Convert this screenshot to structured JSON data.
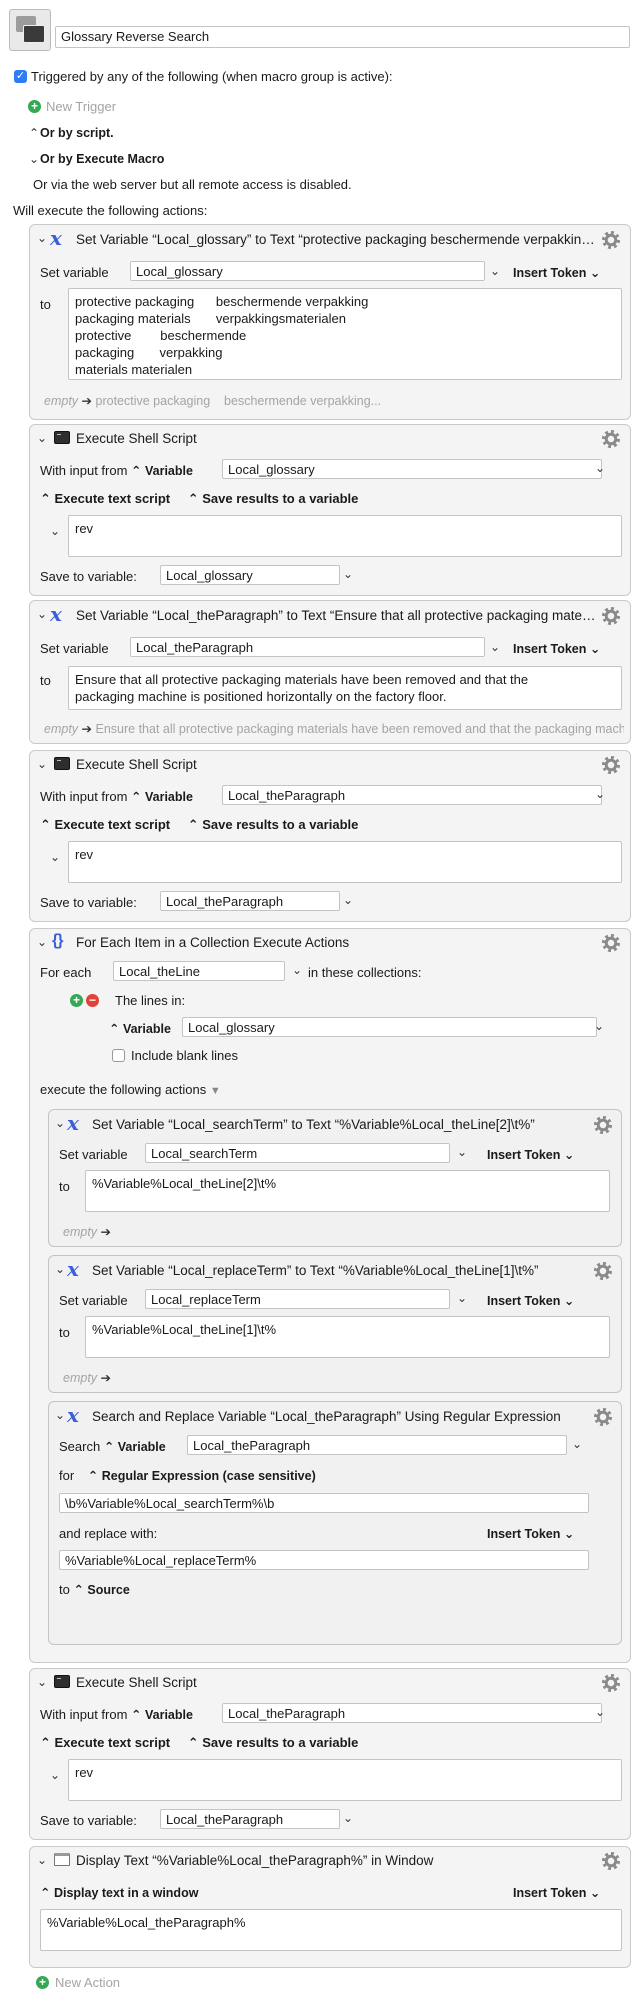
{
  "header": {
    "macro_name": "Glossary Reverse Search",
    "trigger_label": "Triggered by any of the following (when macro group is active):",
    "new_trigger": "New Trigger",
    "or_by_script": "Or by script.",
    "or_by_execute_macro": "Or by Execute Macro",
    "web_server_note": "Or via the web server but all remote access is disabled.",
    "will_execute": "Will execute the following actions:"
  },
  "common": {
    "set_variable": "Set variable",
    "insert_token": "Insert Token",
    "to": "to",
    "empty": "empty",
    "with_input_from": "With input from",
    "variable": "Variable",
    "execute_text_script": "Execute text script",
    "save_results": "Save results to a variable",
    "save_to_variable": "Save to variable:"
  },
  "a1": {
    "title": "Set Variable “Local_glossary” to Text “protective packaging beschermende verpakking…”",
    "variable": "Local_glossary",
    "text_lines": [
      "protective packaging      beschermende verpakking",
      "packaging materials       verpakkingsmaterialen",
      "protective        beschermende",
      "packaging       verpakking",
      "materials materialen"
    ],
    "preview": "protective packaging    beschermende verpakking..."
  },
  "a2": {
    "title": "Execute Shell Script",
    "input_variable": "Local_glossary",
    "script": "rev",
    "save_variable": "Local_glossary"
  },
  "a3": {
    "title": "Set Variable “Local_theParagraph” to Text “Ensure that all protective packaging materials…”",
    "variable": "Local_theParagraph",
    "text_lines": [
      "Ensure that all protective packaging materials have been removed and that the",
      "packaging machine is positioned horizontally on the factory floor."
    ],
    "preview": "Ensure that all protective packaging materials have been removed and that the packaging machine..."
  },
  "a4": {
    "title": "Execute Shell Script",
    "input_variable": "Local_theParagraph",
    "script": "rev",
    "save_variable": "Local_theParagraph"
  },
  "a5": {
    "title": "For Each Item in a Collection Execute Actions",
    "for_each": "For each",
    "loop_variable": "Local_theLine",
    "in_these_collections": "in these collections:",
    "the_lines_in": "The lines in:",
    "collection_variable": "Local_glossary",
    "include_blank_lines": "Include blank lines",
    "execute_following": "execute the following actions",
    "n1": {
      "title": "Set Variable “Local_searchTerm” to Text “%Variable%Local_theLine[2]\\t%”",
      "variable": "Local_searchTerm",
      "text": "%Variable%Local_theLine[2]\\t%"
    },
    "n2": {
      "title": "Set Variable “Local_replaceTerm” to Text “%Variable%Local_theLine[1]\\t%”",
      "variable": "Local_replaceTerm",
      "text": "%Variable%Local_theLine[1]\\t%"
    },
    "n3": {
      "title": "Search and Replace Variable “Local_theParagraph” Using Regular Expression",
      "search": "Search",
      "search_variable": "Local_theParagraph",
      "for": "for",
      "regex_mode": "Regular Expression (case sensitive)",
      "pattern": "\\b%Variable%Local_searchTerm%\\b",
      "and_replace_with": "and replace with:",
      "replacement": "%Variable%Local_replaceTerm%",
      "to": "to",
      "source": "Source"
    }
  },
  "a6": {
    "title": "Execute Shell Script",
    "input_variable": "Local_theParagraph",
    "script": "rev",
    "save_variable": "Local_theParagraph"
  },
  "a7": {
    "title": "Display Text “%Variable%Local_theParagraph%” in Window",
    "mode": "Display text in a window",
    "text": "%Variable%Local_theParagraph%"
  },
  "footer": {
    "new_action": "New Action"
  }
}
